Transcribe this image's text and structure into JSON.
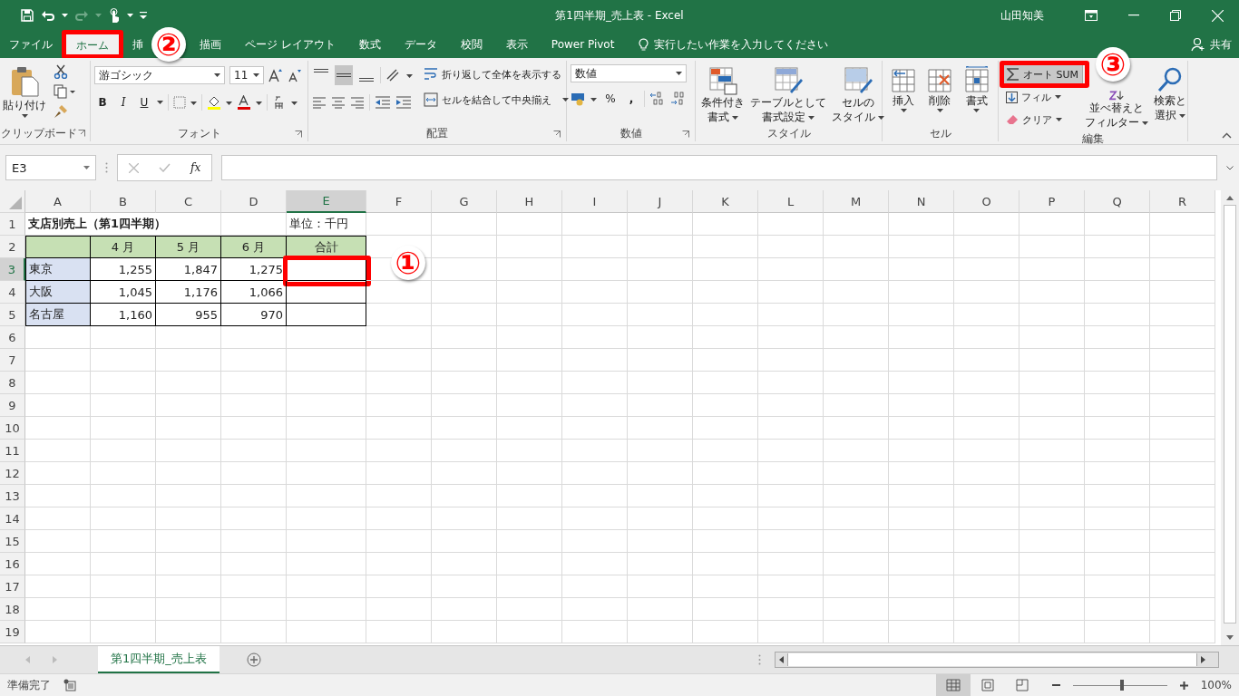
{
  "window": {
    "title": "第1四半期_売上表  -  Excel",
    "user": "山田知美"
  },
  "tabs": [
    {
      "label": "ファイル",
      "selected": false,
      "highlighted": false
    },
    {
      "label": "ホーム",
      "selected": true,
      "highlighted": true
    },
    {
      "label": "挿",
      "selected": false,
      "highlighted": false
    },
    {
      "label": "描画",
      "selected": false,
      "highlighted": false
    },
    {
      "label": "ページ レイアウト",
      "selected": false,
      "highlighted": false
    },
    {
      "label": "数式",
      "selected": false,
      "highlighted": false
    },
    {
      "label": "データ",
      "selected": false,
      "highlighted": false
    },
    {
      "label": "校閲",
      "selected": false,
      "highlighted": false
    },
    {
      "label": "表示",
      "selected": false,
      "highlighted": false
    },
    {
      "label": "Power Pivot",
      "selected": false,
      "highlighted": false
    }
  ],
  "tell_me": "実行したい作業を入力してください",
  "share": "共有",
  "ribbon": {
    "clipboard": {
      "label": "クリップボード",
      "paste": "貼り付け"
    },
    "font": {
      "label": "フォント",
      "name": "游ゴシック",
      "size": "11",
      "bold": "B",
      "italic": "I",
      "underline": "U"
    },
    "alignment": {
      "label": "配置",
      "wrap": "折り返して全体を表示する",
      "merge": "セルを結合して中央揃え",
      "vertical": [
        {
          "selected": false
        },
        {
          "selected": true
        },
        {
          "selected": false
        }
      ]
    },
    "number": {
      "label": "数値",
      "format": "数値",
      "percent": "%",
      "comma": ","
    },
    "styles": {
      "label": "スタイル",
      "buttons": [
        {
          "lines": [
            "条件付き",
            "書式"
          ]
        },
        {
          "lines": [
            "テーブルとして",
            "書式設定"
          ]
        },
        {
          "lines": [
            "セルの",
            "スタイル"
          ]
        }
      ]
    },
    "cells": {
      "label": "セル",
      "buttons": [
        {
          "label": "挿入"
        },
        {
          "label": "削除"
        },
        {
          "label": "書式"
        }
      ]
    },
    "editing": {
      "label": "編集",
      "autosum": {
        "label": "オート SUM",
        "highlighted": true
      },
      "fill": "フィル",
      "clear": "クリア",
      "sort": [
        "並べ替えと",
        "フィルター"
      ],
      "find": [
        "検索と",
        "選択"
      ]
    }
  },
  "formula_bar": {
    "name_box": "E3",
    "fx": "fx"
  },
  "columns": [
    {
      "label": "A",
      "selected": false
    },
    {
      "label": "B",
      "selected": false
    },
    {
      "label": "C",
      "selected": false
    },
    {
      "label": "D",
      "selected": false
    },
    {
      "label": "E",
      "selected": true
    },
    {
      "label": "F",
      "selected": false
    },
    {
      "label": "G",
      "selected": false
    },
    {
      "label": "H",
      "selected": false
    },
    {
      "label": "I",
      "selected": false
    },
    {
      "label": "J",
      "selected": false
    },
    {
      "label": "K",
      "selected": false
    },
    {
      "label": "L",
      "selected": false
    },
    {
      "label": "M",
      "selected": false
    },
    {
      "label": "N",
      "selected": false
    },
    {
      "label": "O",
      "selected": false
    },
    {
      "label": "P",
      "selected": false
    },
    {
      "label": "Q",
      "selected": false
    },
    {
      "label": "R",
      "selected": false
    }
  ],
  "rows": [
    {
      "kind": "title",
      "number": "1",
      "selected": false,
      "title": "支店別売上（第1四半期）",
      "unit": "単位：千円"
    },
    {
      "kind": "header",
      "number": "2",
      "selected": false,
      "months": [
        "4 月",
        "5 月",
        "6 月"
      ],
      "total": "合計"
    },
    {
      "kind": "data",
      "number": "3",
      "selected": true,
      "branch": "東京",
      "values": [
        "1,255",
        "1,847",
        "1,275"
      ],
      "framed": true
    },
    {
      "kind": "data",
      "number": "4",
      "selected": false,
      "branch": "大阪",
      "values": [
        "1,045",
        "1,176",
        "1,066"
      ],
      "framed": false
    },
    {
      "kind": "data",
      "number": "5",
      "selected": false,
      "branch": "名古屋",
      "values": [
        "1,160",
        "955",
        "970"
      ],
      "framed": false
    }
  ],
  "empty_rows": [
    "6",
    "7",
    "8",
    "9",
    "10",
    "11",
    "12",
    "13",
    "14",
    "15",
    "16",
    "17",
    "18",
    "19"
  ],
  "sheet_tabs": [
    {
      "label": "第1四半期_売上表",
      "selected": true
    }
  ],
  "status_bar": {
    "text": "準備完了",
    "zoom": {
      "level": 0.5,
      "reading": "100%"
    }
  },
  "annotations": [
    {
      "text": "②"
    },
    {
      "text": "③"
    },
    {
      "text": "①"
    }
  ]
}
